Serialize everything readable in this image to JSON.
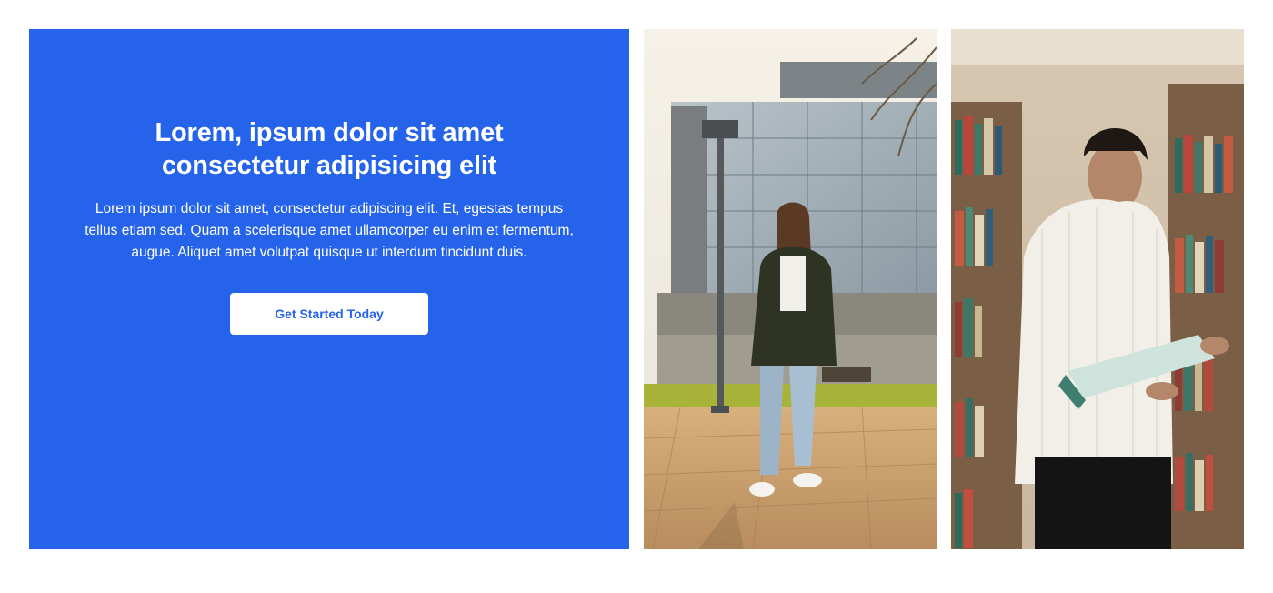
{
  "hero": {
    "title": "Lorem, ipsum dolor sit amet consectetur adipisicing elit",
    "description": "Lorem ipsum dolor sit amet, consectetur adipiscing elit. Et, egestas tempus tellus etiam sed. Quam a scelerisque amet ullamcorper eu enim et fermentum, augue. Aliquet amet volutpat quisque ut interdum tincidunt duis.",
    "cta_label": "Get Started Today"
  },
  "colors": {
    "accent": "#2563eb",
    "button_bg": "#ffffff",
    "button_text": "#2563eb"
  },
  "images": [
    {
      "name": "student-campus-photo"
    },
    {
      "name": "student-library-photo"
    }
  ]
}
